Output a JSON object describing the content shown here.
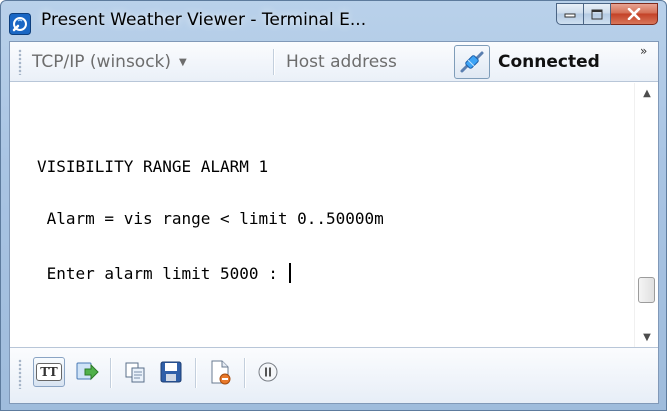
{
  "window": {
    "title": "Present Weather Viewer - Terminal E...",
    "caption_buttons": [
      "minimize",
      "maximize",
      "close"
    ]
  },
  "toolbar": {
    "protocol": "TCP/IP (winsock)",
    "host_placeholder": "Host address",
    "connection_status": "Connected",
    "overflow_symbol": "»",
    "connect_icon": "plug-connected-icon"
  },
  "terminal": {
    "lines": [
      "VISIBILITY RANGE ALARM 1",
      " Alarm = vis range < limit 0..50000m",
      " Enter alarm limit 5000 : "
    ]
  },
  "bottom_toolbar": {
    "buttons": [
      {
        "name": "tt-font",
        "label": "TT",
        "icon": "font-icon"
      },
      {
        "name": "send",
        "icon": "send-icon"
      },
      {
        "name": "copy",
        "icon": "copy-icon"
      },
      {
        "name": "save",
        "icon": "save-icon"
      },
      {
        "name": "clear",
        "icon": "clear-document-icon"
      },
      {
        "name": "pause",
        "icon": "pause-icon"
      }
    ]
  },
  "colors": {
    "frame": "#a9c4e3",
    "close_button": "#c44227",
    "text": "#000000"
  }
}
